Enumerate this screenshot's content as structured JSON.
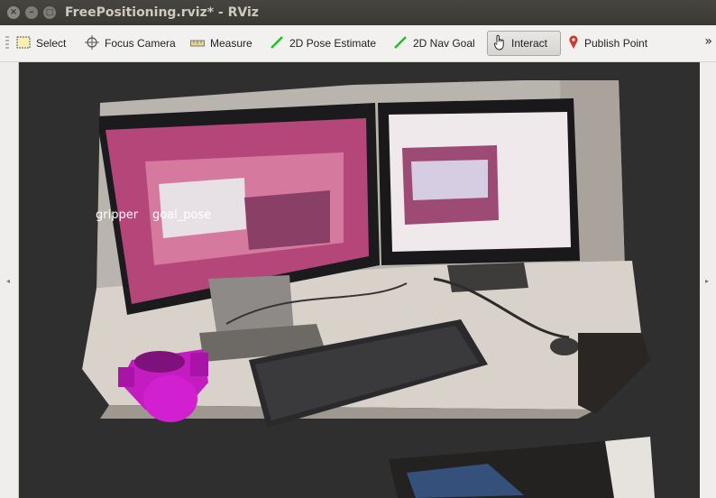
{
  "window": {
    "title": "FreePositioning.rviz* - RViz",
    "close_glyph": "×",
    "minimize_glyph": "–",
    "maximize_glyph": "□"
  },
  "toolbar": {
    "items": [
      {
        "label": "Select",
        "icon": "select-icon"
      },
      {
        "label": "Focus Camera",
        "icon": "focus-camera-icon"
      },
      {
        "label": "Measure",
        "icon": "measure-icon"
      },
      {
        "label": "2D Pose Estimate",
        "icon": "pose-estimate-icon"
      },
      {
        "label": "2D Nav Goal",
        "icon": "nav-goal-icon"
      },
      {
        "label": "Interact",
        "icon": "interact-icon",
        "active": true
      },
      {
        "label": "Publish Point",
        "icon": "publish-point-icon"
      }
    ],
    "overflow": "»"
  },
  "viewport": {
    "labels": {
      "gripper": "gripper",
      "goal_pose": "goal_pose"
    }
  },
  "colors": {
    "accent_magenta": "#d21fd0",
    "pose_green": "#19c21e",
    "publish_red": "#cc3b2e"
  }
}
